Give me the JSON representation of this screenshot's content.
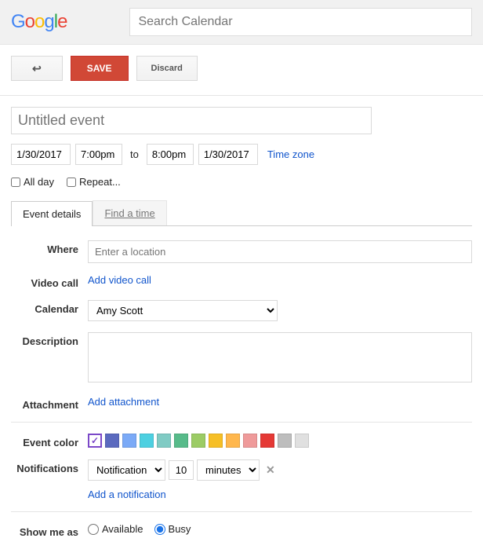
{
  "search": {
    "placeholder": "Search Calendar"
  },
  "actions": {
    "save": "SAVE",
    "discard": "Discard",
    "back_arrow": "↩"
  },
  "event": {
    "title_placeholder": "Untitled event",
    "start_date": "1/30/2017",
    "start_time": "7:00pm",
    "to": "to",
    "end_time": "8:00pm",
    "end_date": "1/30/2017",
    "timezone_link": "Time zone",
    "all_day": "All day",
    "repeat": "Repeat..."
  },
  "tabs": {
    "details": "Event details",
    "find": "Find a time"
  },
  "labels": {
    "where": "Where",
    "video_call": "Video call",
    "calendar": "Calendar",
    "description": "Description",
    "attachment": "Attachment",
    "event_color": "Event color",
    "notifications": "Notifications",
    "show_me_as": "Show me as"
  },
  "fields": {
    "where_placeholder": "Enter a location",
    "add_video_call": "Add video call",
    "calendar_selected": "Amy Scott",
    "add_attachment": "Add attachment",
    "notification_type": "Notification",
    "notification_value": "10",
    "notification_unit": "minutes",
    "add_notification": "Add a notification",
    "available": "Available",
    "busy": "Busy"
  },
  "colors": [
    "#b39ddb",
    "#5b6abf",
    "#7baaf7",
    "#4dd0e1",
    "#80cbc4",
    "#57bb8a",
    "#9ccc65",
    "#f6bf26",
    "#ffb74d",
    "#ef9a9a",
    "#e53935",
    "#bdbdbd",
    "#e0e0e0"
  ],
  "selected_color_index": 0
}
